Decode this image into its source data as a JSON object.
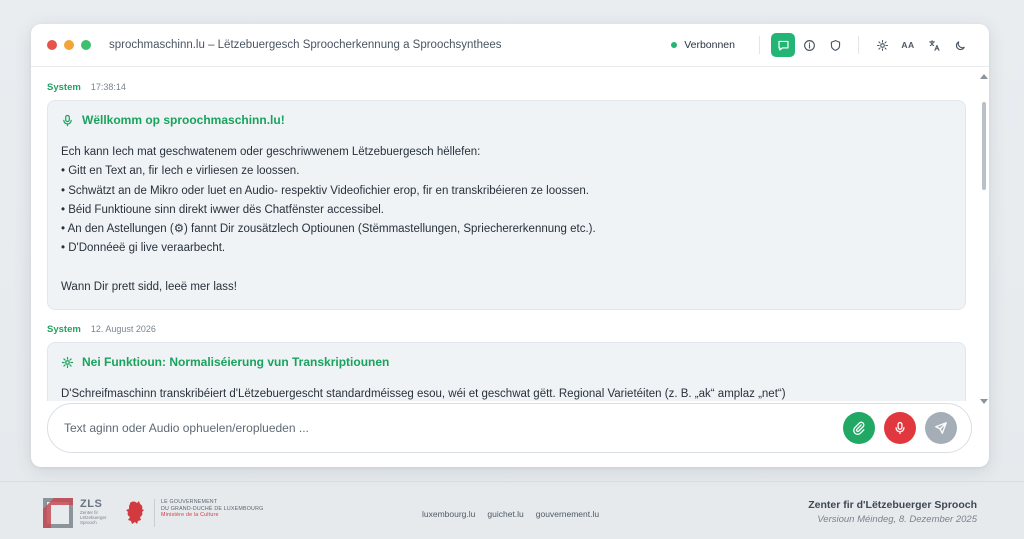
{
  "window": {
    "title": "sprochmaschinn.lu – Lëtzebuergesch Sproocherkennung a Sproochsynthees",
    "status": "Verbonnen",
    "toolbar": {
      "text_size_label": "AA"
    }
  },
  "messages": [
    {
      "sender": "System",
      "time": "17:38:14",
      "heading": "Wëllkomm op sproochmaschinn.lu!",
      "icon": "microphone-icon",
      "lines": [
        "Ech kann Iech mat geschwatenem oder geschriwwenem Lëtzebuergesch hëllefen:",
        "• Gitt en Text an, fir Iech e virliesen ze loossen.",
        "• Schwätzt an de Mikro oder luet en Audio- respektiv Videofichier erop, fir en transkribéieren ze loossen.",
        "• Béid Funktioune sinn direkt iwwer dës Chatfënster accessibel.",
        "• An den Astellungen (⚙) fannt Dir zousätzlech Optiounen (Stëmmastellungen, Spriechererkennung etc.).",
        "• D'Donnéeë gi live veraarbecht."
      ],
      "closing": "Wann Dir prett sidd, leeë mer lass!"
    },
    {
      "sender": "System",
      "time": "12. August 2026",
      "heading": "Nei Funktioun: Normaliséierung vun Transkriptiounen",
      "icon": "gear-icon",
      "lines": [
        "D'Schreifmaschinn transkribéiert d'Lëtzebuergescht standardméisseg esou, wéi et geschwat gëtt. Regional Varietéiten (z. B. „ak“ amplaz „net“)"
      ]
    }
  ],
  "input": {
    "placeholder": "Text aginn oder Audio ophuelen/eroplueden ..."
  },
  "footer": {
    "zls_abbr": "ZLS",
    "zls_sub": [
      "Zenter fir",
      "Lëtzebuerger",
      "Sprooch"
    ],
    "gov_lines": [
      "LE GOUVERNEMENT",
      "DU GRAND-DUCHÉ DE LUXEMBOURG"
    ],
    "gov_ministry": "Ministère de la Culture",
    "links": [
      "luxembourg.lu",
      "guichet.lu",
      "gouvernement.lu"
    ],
    "org": "Zenter fir d'Lëtzebuerger Sprooch",
    "version": "Versioun Méindeg, 8. Dezember 2025"
  },
  "colors": {
    "accent_green": "#22b573",
    "heading_green": "#18a35d",
    "mic_red": "#e0383e",
    "send_gray": "#a5adb7"
  }
}
